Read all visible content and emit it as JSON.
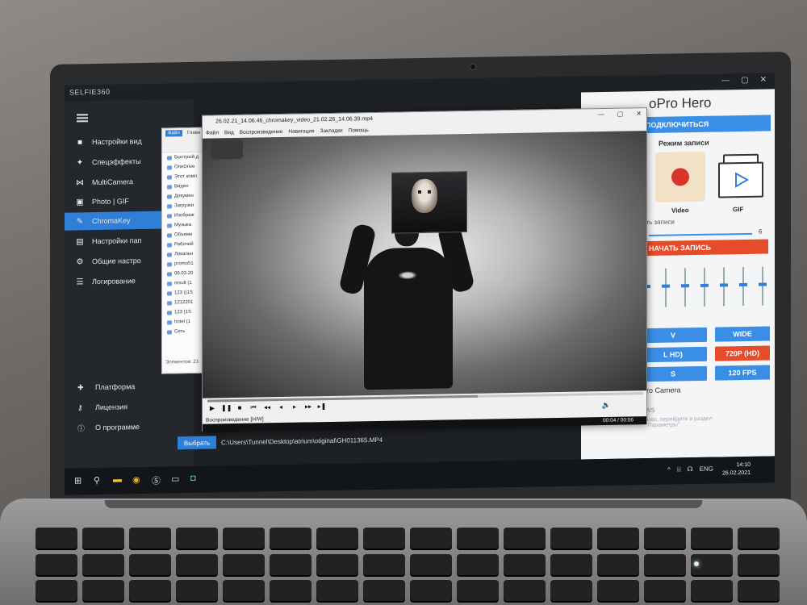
{
  "app": {
    "title": "SELFIE360",
    "window_controls": [
      "—",
      "▢",
      "✕"
    ]
  },
  "sidebar": {
    "items": [
      {
        "icon": "video-camera-icon",
        "glyph": "■",
        "label": "Настройки вид"
      },
      {
        "icon": "effects-icon",
        "glyph": "✦",
        "label": "Спецэффекты"
      },
      {
        "icon": "multicamera-icon",
        "glyph": "⋈",
        "label": "MultiCamera"
      },
      {
        "icon": "photo-icon",
        "glyph": "▣",
        "label": "Photo | GIF"
      },
      {
        "icon": "chromakey-icon",
        "glyph": "✎",
        "label": "ChromaKey",
        "active": true
      },
      {
        "icon": "folder-settings-icon",
        "glyph": "▤",
        "label": "Настройки пап"
      },
      {
        "icon": "gear-icon",
        "glyph": "⚙",
        "label": "Общие настро"
      },
      {
        "icon": "log-icon",
        "glyph": "☰",
        "label": "Логирование"
      }
    ],
    "bottom_items": [
      {
        "icon": "platform-icon",
        "glyph": "✚",
        "label": "Платформа"
      },
      {
        "icon": "license-icon",
        "glyph": "⚷",
        "label": "Лицензия"
      },
      {
        "icon": "info-icon",
        "glyph": "ⓘ",
        "label": "О программе"
      }
    ]
  },
  "right_panel": {
    "title": "oPro Hero",
    "connect_label": "ПОДКЛЮЧИТЬСЯ",
    "mode_label": "Режим записи",
    "video_label": "Video",
    "gif_label": "GIF",
    "duration_label": "ость записи",
    "duration_value": "6",
    "record_label": "НАЧАТЬ ЗАПИСЬ",
    "fader_levels": [
      0.45,
      0.45,
      0.45,
      0.45,
      0.45,
      0.45,
      0.45,
      0.45
    ],
    "buttons": [
      {
        "label": "V",
        "color": "#3a8ee6"
      },
      {
        "label": "WIDE",
        "color": "#3a8ee6"
      },
      {
        "label": "L HD)",
        "color": "#3a8ee6"
      },
      {
        "label": "720P (HD)",
        "color": "#e64b2a"
      },
      {
        "label": "S",
        "color": "#3a8ee6"
      },
      {
        "label": "120 FPS",
        "color": "#3a8ee6"
      }
    ],
    "camera_caption": "oPro Camera",
    "activate_title": "ows",
    "activate_hint": "зовс, перейдите в раздел\n\"Параметры\""
  },
  "explorer": {
    "tabs": [
      "Файл",
      "Главн"
    ],
    "items": [
      "Быстрый д",
      "OneDrive",
      "Этот комп",
      "Видео",
      "Докумен",
      "Загрузки",
      "Изображ",
      "Музыка",
      "Объемн",
      "Рабочий",
      "Локальн",
      "promo51",
      "06.03.20",
      "result (1",
      "123 ((1S",
      "1212201",
      "123 (1S",
      "hotel (1",
      "Сеть"
    ],
    "footer": "Элементов: 23"
  },
  "player": {
    "title": "26.02.21_14.06.46_chromakey_video_21.02.26_14.06.39.mp4",
    "window_controls": [
      "—",
      "▢",
      "✕"
    ],
    "menu": [
      "Файл",
      "Вид",
      "Воспроизведение",
      "Навигация",
      "Закладки",
      "Помощь"
    ],
    "controls": [
      "▶",
      "❚❚",
      "■",
      "⏮",
      "◂◂",
      "◂",
      "▸",
      "▸▸",
      "▸❚"
    ],
    "status": "Воспроизведение [H/W]",
    "time": "00:04 / 00:06",
    "progress": 0.62,
    "volume_glyph": "🔈"
  },
  "path_row": {
    "button_label": "Выбрать",
    "path": "C:\\Users\\Tunnel\\Desktop\\atrium\\otiginal\\GH011365.MP4"
  },
  "taskbar": {
    "apps": [
      "⊞",
      "⚲",
      "▬",
      "◉",
      "Ⓢ",
      "▭",
      "◘"
    ],
    "tray": [
      "^",
      "⌸",
      "☊",
      "ENG"
    ],
    "time": "14:10",
    "date": "26.02.2021"
  }
}
